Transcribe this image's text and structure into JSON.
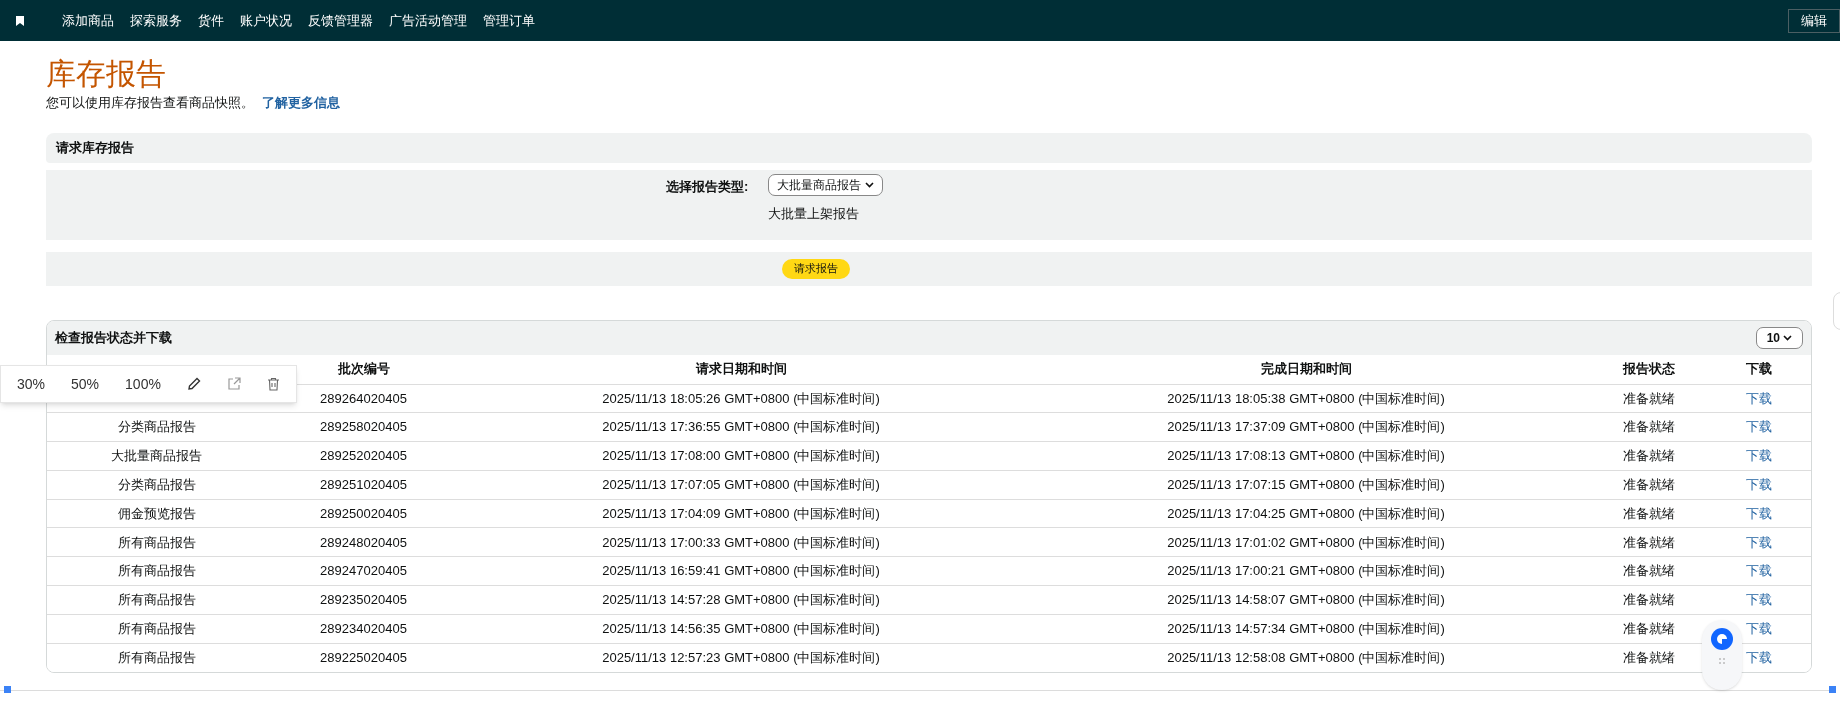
{
  "nav": {
    "items": [
      "添加商品",
      "探索服务",
      "货件",
      "账户状况",
      "反馈管理器",
      "广告活动管理",
      "管理订单"
    ],
    "edit_button": "编辑"
  },
  "page": {
    "title": "库存报告",
    "description": "您可以使用库存报告查看商品快照。",
    "learn_more": "了解更多信息"
  },
  "request_section": {
    "title": "请求库存报告",
    "type_label": "选择报告类型:",
    "type_value": "大批量商品报告",
    "type_description": "大批量上架报告",
    "request_button": "请求报告"
  },
  "status_section": {
    "title": "检查报告状态并下载",
    "page_size": "10",
    "table": {
      "columns": [
        "批次编号",
        "请求日期和时间",
        "完成日期和时间",
        "报告状态",
        "下载"
      ],
      "rows": [
        {
          "type": "",
          "batch": "289264020405",
          "requested": "2025/11/13 18:05:26 GMT+0800 (中国标准时间)",
          "completed": "2025/11/13 18:05:38 GMT+0800 (中国标准时间)",
          "status": "准备就绪",
          "download": "下载"
        },
        {
          "type": "分类商品报告",
          "batch": "289258020405",
          "requested": "2025/11/13 17:36:55 GMT+0800 (中国标准时间)",
          "completed": "2025/11/13 17:37:09 GMT+0800 (中国标准时间)",
          "status": "准备就绪",
          "download": "下载"
        },
        {
          "type": "大批量商品报告",
          "batch": "289252020405",
          "requested": "2025/11/13 17:08:00 GMT+0800 (中国标准时间)",
          "completed": "2025/11/13 17:08:13 GMT+0800 (中国标准时间)",
          "status": "准备就绪",
          "download": "下载"
        },
        {
          "type": "分类商品报告",
          "batch": "289251020405",
          "requested": "2025/11/13 17:07:05 GMT+0800 (中国标准时间)",
          "completed": "2025/11/13 17:07:15 GMT+0800 (中国标准时间)",
          "status": "准备就绪",
          "download": "下载"
        },
        {
          "type": "佣金预览报告",
          "batch": "289250020405",
          "requested": "2025/11/13 17:04:09 GMT+0800 (中国标准时间)",
          "completed": "2025/11/13 17:04:25 GMT+0800 (中国标准时间)",
          "status": "准备就绪",
          "download": "下载"
        },
        {
          "type": "所有商品报告",
          "batch": "289248020405",
          "requested": "2025/11/13 17:00:33 GMT+0800 (中国标准时间)",
          "completed": "2025/11/13 17:01:02 GMT+0800 (中国标准时间)",
          "status": "准备就绪",
          "download": "下载"
        },
        {
          "type": "所有商品报告",
          "batch": "289247020405",
          "requested": "2025/11/13 16:59:41 GMT+0800 (中国标准时间)",
          "completed": "2025/11/13 17:00:21 GMT+0800 (中国标准时间)",
          "status": "准备就绪",
          "download": "下载"
        },
        {
          "type": "所有商品报告",
          "batch": "289235020405",
          "requested": "2025/11/13 14:57:28 GMT+0800 (中国标准时间)",
          "completed": "2025/11/13 14:58:07 GMT+0800 (中国标准时间)",
          "status": "准备就绪",
          "download": "下载"
        },
        {
          "type": "所有商品报告",
          "batch": "289234020405",
          "requested": "2025/11/13 14:56:35 GMT+0800 (中国标准时间)",
          "completed": "2025/11/13 14:57:34 GMT+0800 (中国标准时间)",
          "status": "准备就绪",
          "download": "下载"
        },
        {
          "type": "所有商品报告",
          "batch": "289225020405",
          "requested": "2025/11/13 12:57:23 GMT+0800 (中国标准时间)",
          "completed": "2025/11/13 12:58:08 GMT+0800 (中国标准时间)",
          "status": "准备就绪",
          "download": "下载"
        }
      ]
    }
  },
  "zoom_toolbar": {
    "levels": [
      "30%",
      "50%",
      "100%"
    ]
  }
}
